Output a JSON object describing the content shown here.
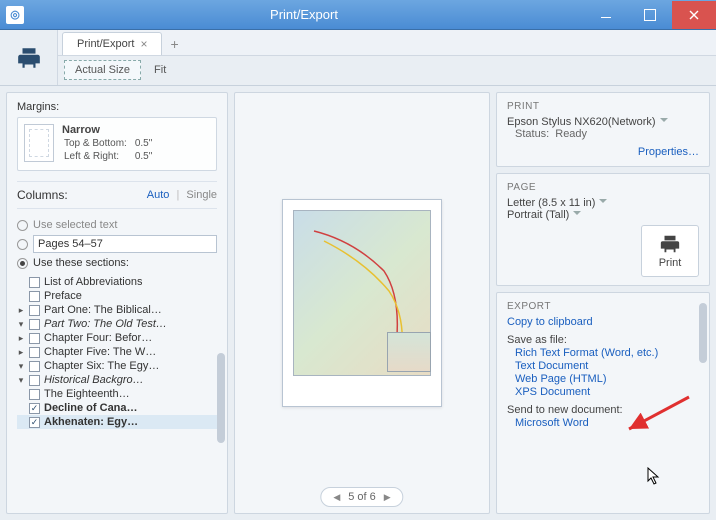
{
  "window": {
    "title": "Print/Export"
  },
  "tab": {
    "label": "Print/Export"
  },
  "sizes": {
    "actual": "Actual Size",
    "fit": "Fit"
  },
  "margins": {
    "label": "Margins:",
    "name": "Narrow",
    "tb_label": "Top & Bottom:",
    "tb_val": "0.5\"",
    "lr_label": "Left & Right:",
    "lr_val": "0.5\""
  },
  "columns": {
    "label": "Columns:",
    "auto": "Auto",
    "single": "Single"
  },
  "range": {
    "use_selected": "Use selected text",
    "pages_value": "Pages 54–57",
    "use_sections": "Use these sections:"
  },
  "tree": {
    "n0": "List of Abbreviations",
    "n1": "Preface",
    "n2": "Part One: The Biblical…",
    "n3": "Part Two: The Old Test…",
    "n4": "Chapter Four: Befor…",
    "n5": "Chapter Five: The W…",
    "n6": "Chapter Six: The Egy…",
    "n7": "Historical Backgro…",
    "n8": "The Eighteenth…",
    "n9": "Decline of Cana…",
    "n10": "Akhenaten: Egy…"
  },
  "pager": {
    "text": "5 of 6"
  },
  "print": {
    "title": "PRINT",
    "printer": "Epson Stylus NX620(Network)",
    "status_label": "Status:",
    "status_value": "Ready",
    "properties": "Properties…"
  },
  "page": {
    "title": "PAGE",
    "size": "Letter (8.5 x 11 in)",
    "orient": "Portrait (Tall)",
    "print_btn": "Print"
  },
  "export": {
    "title": "EXPORT",
    "clipboard": "Copy to clipboard",
    "saveas": "Save as file:",
    "rtf": "Rich Text Format (Word, etc.)",
    "txt": "Text Document",
    "html": "Web Page (HTML)",
    "xps": "XPS Document",
    "sendto": "Send to new document:",
    "msword": "Microsoft Word"
  }
}
